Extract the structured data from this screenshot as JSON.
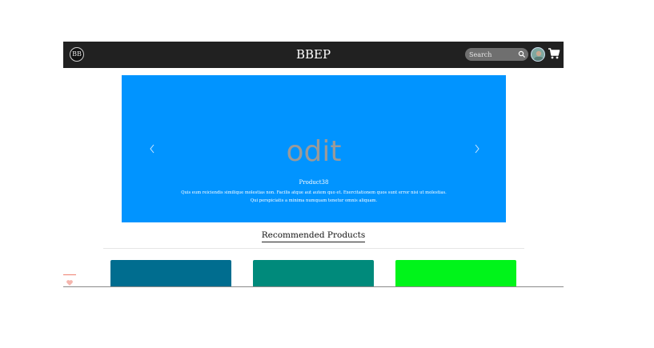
{
  "header": {
    "brand": "BBEP",
    "logo_text": "BB",
    "search": {
      "placeholder": "Search"
    }
  },
  "hero": {
    "image_text": "odit",
    "title": "Product38",
    "description": "Quis eum reiciendis similique molestias non. Facilis atque aut autem quo et. Exercitationem quos sunt error nisi ut molestias. Qui perspiciatis a minima numquam tenetur omnis aliquam.",
    "background": "#0194ff"
  },
  "recommended": {
    "title": "Recommended Products",
    "cards": [
      {
        "color": "#006d8f"
      },
      {
        "color": "#008a7b"
      },
      {
        "color": "#00f41a"
      }
    ]
  },
  "colors": {
    "navbar": "#212121",
    "accent": "#0194ff"
  },
  "icons": [
    "logo-icon",
    "search-icon",
    "avatar",
    "cart-icon",
    "chevron-left-icon",
    "chevron-right-icon",
    "heart-icon"
  ]
}
